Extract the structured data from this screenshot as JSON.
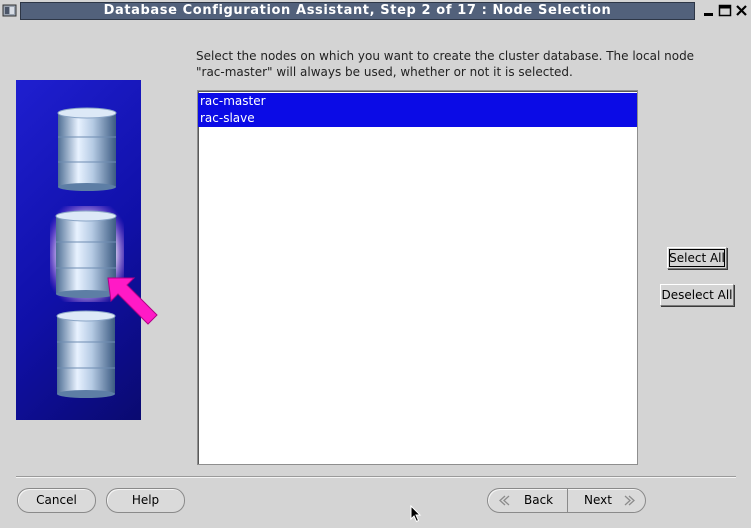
{
  "window": {
    "title": "Database Configuration Assistant, Step 2 of 17 : Node Selection"
  },
  "instruction": "Select the nodes on which you want to create the cluster database. The local node \"rac-master\" will always be used, whether or not it is selected.",
  "nodes": [
    {
      "name": "rac-master",
      "selected": true
    },
    {
      "name": "rac-slave",
      "selected": true
    }
  ],
  "buttons": {
    "select_all": "Select All",
    "deselect_all": "Deselect All",
    "cancel": "Cancel",
    "help": "Help",
    "back": "Back",
    "next": "Next"
  },
  "colors": {
    "title_bar": "#52617b",
    "selection": "#0b0be6",
    "wizard_panel": "#1414b4",
    "arrow": "#ff1ac6"
  }
}
